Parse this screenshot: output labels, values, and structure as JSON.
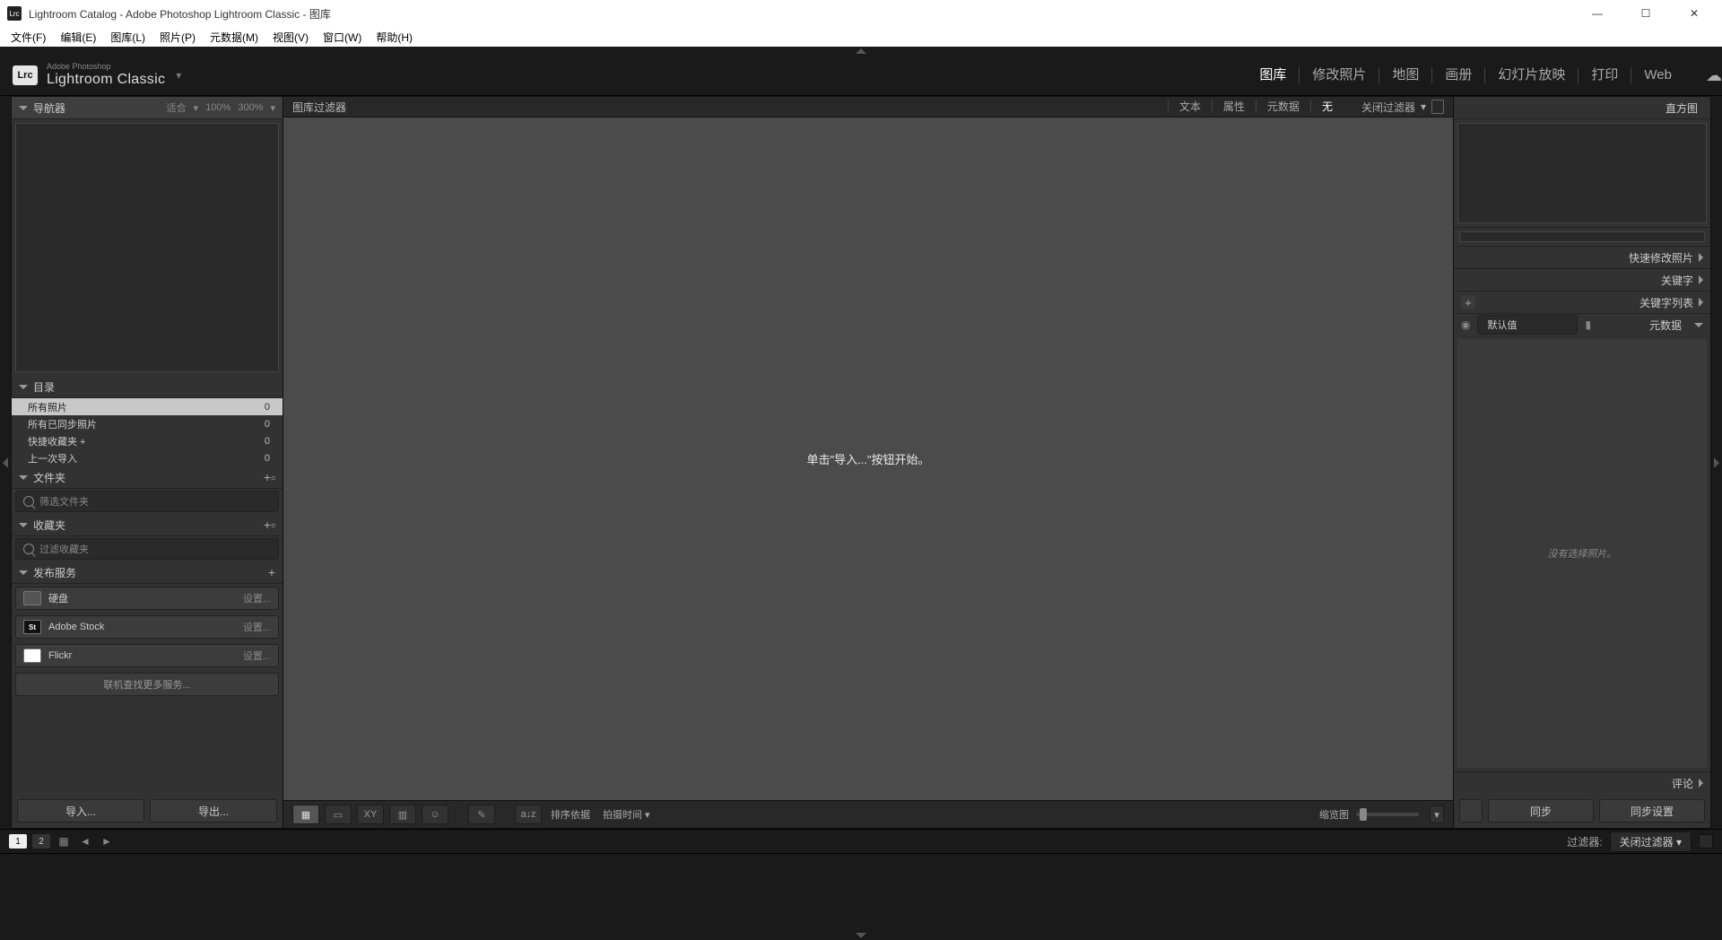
{
  "window": {
    "title": "Lightroom Catalog - Adobe Photoshop Lightroom Classic - 图库",
    "icon_text": "Lrc"
  },
  "menu": {
    "file": "文件(F)",
    "edit": "编辑(E)",
    "library": "图库(L)",
    "photo": "照片(P)",
    "metadata": "元数据(M)",
    "view": "视图(V)",
    "window": "窗口(W)",
    "help": "帮助(H)"
  },
  "identity": {
    "sub": "Adobe Photoshop",
    "main": "Lightroom Classic",
    "caret": "▾"
  },
  "modules": {
    "library": "图库",
    "develop": "修改照片",
    "map": "地图",
    "book": "画册",
    "slideshow": "幻灯片放映",
    "print": "打印",
    "web": "Web"
  },
  "left": {
    "navigator": {
      "title": "导航器",
      "fit": "适合",
      "z100": "100%",
      "z300": "300%"
    },
    "catalog": {
      "title": "目录",
      "items": [
        {
          "label": "所有照片",
          "count": "0"
        },
        {
          "label": "所有已同步照片",
          "count": "0"
        },
        {
          "label": "快捷收藏夹 +",
          "count": "0"
        },
        {
          "label": "上一次导入",
          "count": "0"
        }
      ]
    },
    "folders": {
      "title": "文件夹",
      "filter": "筛选文件夹"
    },
    "collections": {
      "title": "收藏夹",
      "filter": "过滤收藏夹"
    },
    "publish": {
      "title": "发布服务",
      "hd": "硬盘",
      "stock": "Adobe Stock",
      "flickr": "Flickr",
      "setup": "设置...",
      "more": "联机查找更多服务..."
    },
    "buttons": {
      "import": "导入...",
      "export": "导出..."
    }
  },
  "center": {
    "filter_label": "图库过滤器",
    "tabs": {
      "text": "文本",
      "attr": "属性",
      "meta": "元数据",
      "none": "无"
    },
    "close_filter": "关闭过滤器",
    "empty": "单击\"导入...\"按钮开始。",
    "toolbar": {
      "sort_by": "排序依据",
      "sort_field": "拍摄时间",
      "thumb": "缩览图"
    }
  },
  "right": {
    "histogram": "直方图",
    "quick_dev": "快速修改照片",
    "keywording": "关键字",
    "keyword_list": "关键字列表",
    "metadata": "元数据",
    "default": "默认值",
    "no_photo": "没有选择照片。",
    "comments": "评论",
    "sync": "同步",
    "sync_settings": "同步设置"
  },
  "status": {
    "page1": "1",
    "page2": "2",
    "filter_label": "过滤器:",
    "filter_value": "关闭过滤器"
  }
}
